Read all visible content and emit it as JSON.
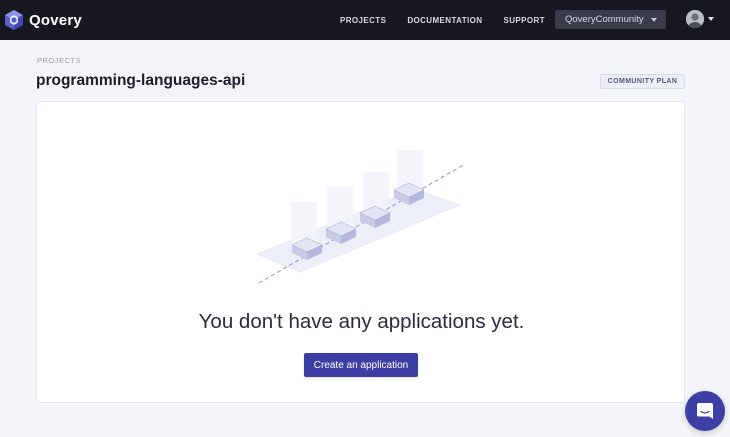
{
  "app": {
    "name": "Qovery"
  },
  "nav": {
    "items": [
      {
        "label": "PROJECTS"
      },
      {
        "label": "DOCUMENTATION"
      },
      {
        "label": "SUPPORT"
      }
    ]
  },
  "org_selector": {
    "value": "QoveryCommunity"
  },
  "breadcrumb": {
    "label": "PROJECTS"
  },
  "page": {
    "title": "programming-languages-api"
  },
  "plan_badge": {
    "label": "COMMUNITY PLAN"
  },
  "empty_state": {
    "message": "You don't have any applications yet.",
    "action_label": "Create an application"
  },
  "colors": {
    "topbar": "#16171f",
    "accent": "#3d3fa4",
    "background": "#f4f5f9"
  },
  "icons": {
    "logo": "qovery-logo-icon",
    "chat": "chat-bubble-icon",
    "avatar": "user-avatar"
  }
}
